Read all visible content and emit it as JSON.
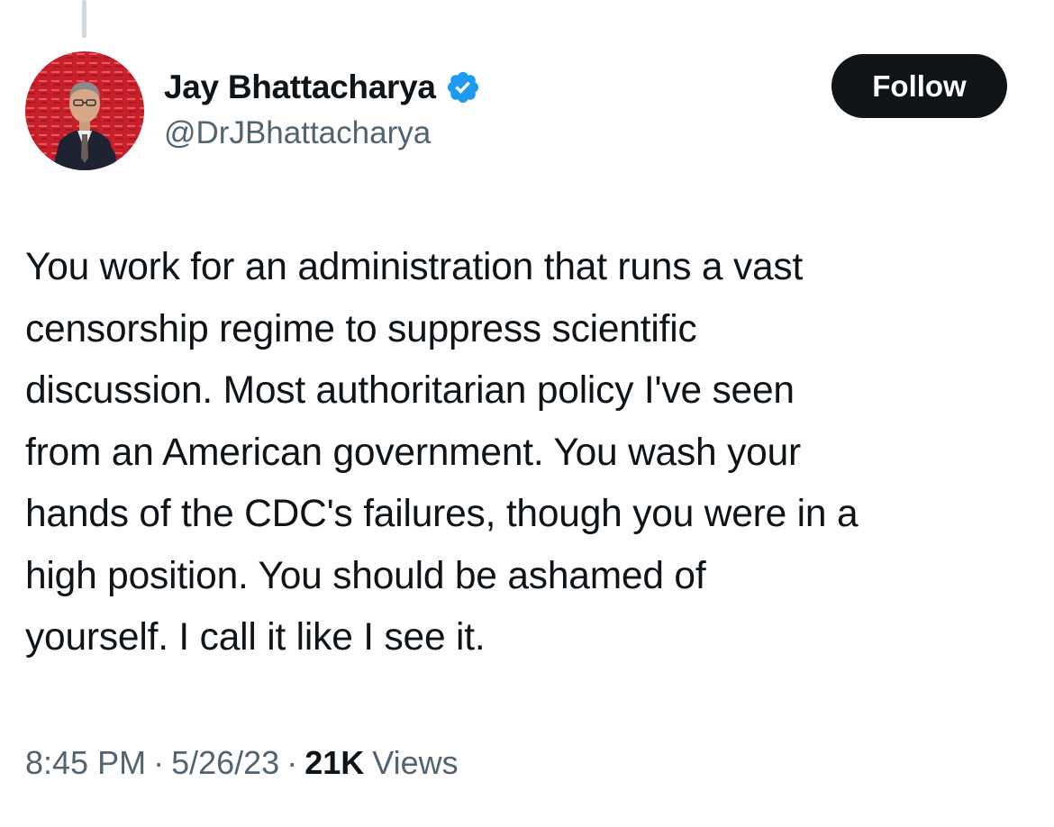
{
  "author": {
    "display_name": "Jay Bhattacharya",
    "handle": "@DrJBhattacharya",
    "verified_icon": "verified-badge-icon",
    "accent_color": "#1d9bf0"
  },
  "follow_button": {
    "label": "Follow"
  },
  "tweet": {
    "lines": [
      "You work for an administration that runs a vast",
      "censorship regime to suppress scientific",
      "discussion. Most authoritarian policy I've seen",
      "from an American government. You wash your",
      "hands of the CDC's failures, though you were in a",
      "high position. You should be ashamed of",
      "yourself. I call it like I see it."
    ]
  },
  "meta": {
    "time": "8:45 PM",
    "separator": "·",
    "date": "5/26/23",
    "views_count": "21K",
    "views_label": "Views"
  }
}
